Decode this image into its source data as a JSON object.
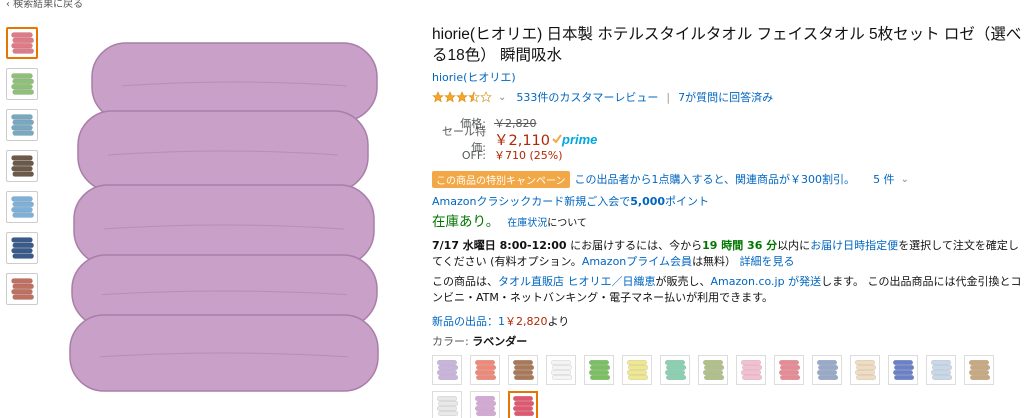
{
  "back_link": "‹ 検索結果に戻る",
  "thumbnails": [
    {
      "icon": "towel-stack-pink-icon",
      "color": "#e07a86",
      "active": true
    },
    {
      "icon": "product-info-icon",
      "color": "#8fc07a",
      "active": false
    },
    {
      "icon": "towel-colors-icon",
      "color": "#7aa8c0",
      "active": false
    },
    {
      "icon": "lifestyle-photo-icon",
      "color": "#6b5a4a",
      "active": false
    },
    {
      "icon": "feature-chart-icon",
      "color": "#7fb0d8",
      "active": false
    },
    {
      "icon": "towel-detail-icon",
      "color": "#3a5a8a",
      "active": false
    },
    {
      "icon": "towel-folded-icon",
      "color": "#c07060",
      "active": false
    }
  ],
  "product": {
    "main_image_color": "#c9a0c8",
    "title": "hiorie(ヒオリエ) 日本製 ホテルスタイルタオル フェイスタオル 5枚セット ロゼ（選べる18色） 瞬間吸水",
    "brand": "hiorie(ヒオリエ)",
    "stars": 3.5,
    "reviews_link": "533件のカスタマーレビュー",
    "questions_link": "7が質問に回答済み"
  },
  "pricing": {
    "list_label": "価格:",
    "list_price": "￥2,820",
    "sale_label": "セール特価:",
    "sale_price": "￥2,110",
    "prime": "prime",
    "off_label": "OFF:",
    "off_value": "￥710 (25%)"
  },
  "promo": {
    "badge": "この商品の特別キャンペーン",
    "text": "この出品者から1点購入すると、関連商品が￥300割引。",
    "count": "5 件"
  },
  "card": {
    "text_before": "Amazonクラシックカード新規ご入会で",
    "points": "5,000",
    "text_after": "ポイント"
  },
  "stock": {
    "status": "在庫あり。",
    "link": "在庫状況",
    "suffix": "について"
  },
  "delivery": {
    "date": "7/17 水曜日 8:00-12:00",
    "t1": " にお届けするには、今から",
    "hours": "19 時間 36 分",
    "t2": "以内に",
    "link1": "お届け日時指定便",
    "t3": "を選択して注文を確定してください (有料オプション。",
    "link2": "Amazonプライム会員",
    "t4": "は無料） ",
    "link3": "詳細を見る"
  },
  "seller": {
    "t1": "この商品は、",
    "link1": "タオル直販店 ヒオリエ／日織恵",
    "t2": "が販売し、",
    "link2": "Amazon.co.jp が発送",
    "t3": "します。 この出品商品には代金引換とコンビニ・ATM・ネットバンキング・電子マネー払いが利用できます。"
  },
  "new_items": {
    "label": "新品の出品：1",
    "price": "￥2,820",
    "suffix": "より"
  },
  "color": {
    "label": "カラー: ",
    "value": "ラベンダー"
  },
  "swatches": [
    {
      "color": "#c8b4dc",
      "selected": false
    },
    {
      "color": "#f08878",
      "selected": false
    },
    {
      "color": "#a87858",
      "selected": false
    },
    {
      "color": "#f4f4f4",
      "selected": false
    },
    {
      "color": "#78c060",
      "selected": false
    },
    {
      "color": "#f0e890",
      "selected": false
    },
    {
      "color": "#88d0b0",
      "selected": false
    },
    {
      "color": "#b0c088",
      "selected": false
    },
    {
      "color": "#f4c0d0",
      "selected": false
    },
    {
      "color": "#e88a94",
      "selected": false
    },
    {
      "color": "#98a8c8",
      "selected": false
    },
    {
      "color": "#f0dcc0",
      "selected": false
    },
    {
      "color": "#6a80c8",
      "selected": false
    },
    {
      "color": "#c8d8e8",
      "selected": false
    },
    {
      "color": "#c8a880",
      "selected": false
    },
    {
      "color": "#e8e8e8",
      "selected": false
    },
    {
      "color": "#d4a8d4",
      "selected": false
    },
    {
      "color": "#e05870",
      "selected": true
    }
  ]
}
